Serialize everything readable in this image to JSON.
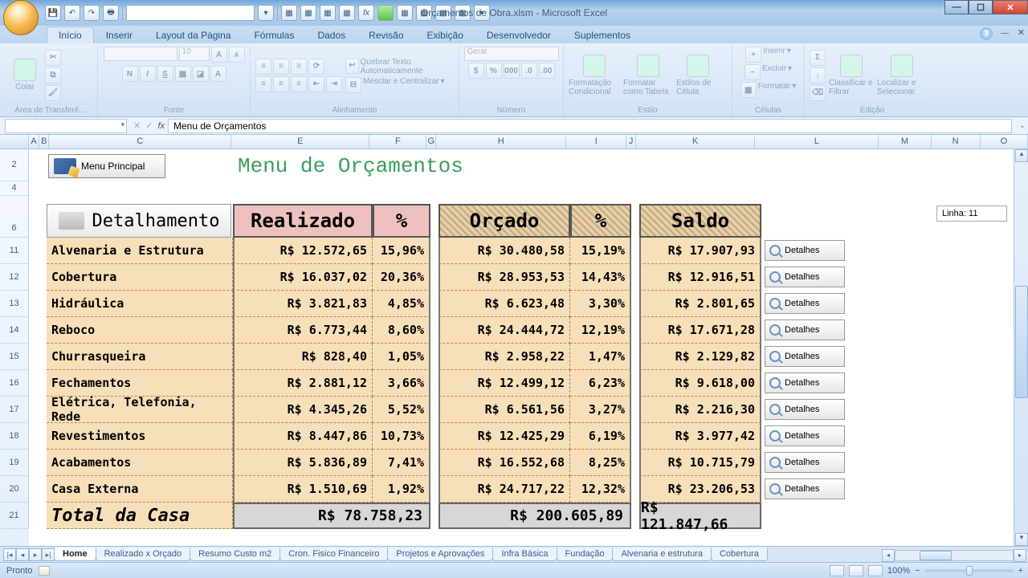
{
  "app": {
    "title": "Orçamentos de Obra.xlsm - Microsoft Excel"
  },
  "ribbon_tabs": [
    "Início",
    "Inserir",
    "Layout da Página",
    "Fórmulas",
    "Dados",
    "Revisão",
    "Exibição",
    "Desenvolvedor",
    "Suplementos"
  ],
  "ribbon_groups": {
    "clipboard": "Área de Transferê...",
    "clipboard_paste": "Colar",
    "font": "Fonte",
    "fontsize": "10",
    "alignment": "Alinhamento",
    "wrap": "Quebrar Texto Automaticamente",
    "merge": "Mesclar e Centralizar",
    "number": "Número",
    "number_format": "Geral",
    "styles": "Estilo",
    "cf": "Formatação Condicional",
    "tbl": "Formatar como Tabela",
    "cellst": "Estilos de Célula",
    "cells": "Células",
    "ins": "Inserir",
    "del": "Excluir",
    "fmt": "Formatar",
    "editing": "Edição",
    "sort": "Classificar e Filtrar",
    "find": "Localizar e Selecionar"
  },
  "formula_bar": {
    "namebox": "",
    "formula": "Menu de Orçamentos"
  },
  "columns": [
    "A",
    "B",
    "C",
    "E",
    "F",
    "G",
    "H",
    "I",
    "J",
    "K",
    "L",
    "M",
    "N",
    "O"
  ],
  "row_numbers": [
    "2",
    "4",
    "6",
    "11",
    "12",
    "13",
    "14",
    "15",
    "16",
    "17",
    "18",
    "19",
    "20",
    "21"
  ],
  "menu_principal": "Menu Principal",
  "page_title": "Menu de Orçamentos",
  "linha": "Linha: 11",
  "detal": "Detalhamento",
  "headers": {
    "realizado": "Realizado",
    "r_pct": "%",
    "orcado": "Orçado",
    "o_pct": "%",
    "saldo": "Saldo"
  },
  "det_label": "Detalhes",
  "rows": [
    {
      "name": "Alvenaria e Estrutura",
      "realizado": "R$ 12.572,65",
      "r_pct": "15,96%",
      "orcado": "R$ 30.480,58",
      "o_pct": "15,19%",
      "saldo": "R$ 17.907,93"
    },
    {
      "name": "Cobertura",
      "realizado": "R$ 16.037,02",
      "r_pct": "20,36%",
      "orcado": "R$ 28.953,53",
      "o_pct": "14,43%",
      "saldo": "R$ 12.916,51"
    },
    {
      "name": "Hidráulica",
      "realizado": "R$ 3.821,83",
      "r_pct": "4,85%",
      "orcado": "R$ 6.623,48",
      "o_pct": "3,30%",
      "saldo": "R$ 2.801,65"
    },
    {
      "name": "Reboco",
      "realizado": "R$ 6.773,44",
      "r_pct": "8,60%",
      "orcado": "R$ 24.444,72",
      "o_pct": "12,19%",
      "saldo": "R$ 17.671,28"
    },
    {
      "name": "Churrasqueira",
      "realizado": "R$ 828,40",
      "r_pct": "1,05%",
      "orcado": "R$ 2.958,22",
      "o_pct": "1,47%",
      "saldo": "R$ 2.129,82"
    },
    {
      "name": "Fechamentos",
      "realizado": "R$ 2.881,12",
      "r_pct": "3,66%",
      "orcado": "R$ 12.499,12",
      "o_pct": "6,23%",
      "saldo": "R$ 9.618,00"
    },
    {
      "name": "Elétrica, Telefonia, Rede",
      "realizado": "R$ 4.345,26",
      "r_pct": "5,52%",
      "orcado": "R$ 6.561,56",
      "o_pct": "3,27%",
      "saldo": "R$ 2.216,30"
    },
    {
      "name": "Revestimentos",
      "realizado": "R$ 8.447,86",
      "r_pct": "10,73%",
      "orcado": "R$ 12.425,29",
      "o_pct": "6,19%",
      "saldo": "R$ 3.977,42"
    },
    {
      "name": "Acabamentos",
      "realizado": "R$ 5.836,89",
      "r_pct": "7,41%",
      "orcado": "R$ 16.552,68",
      "o_pct": "8,25%",
      "saldo": "R$ 10.715,79"
    },
    {
      "name": "Casa Externa",
      "realizado": "R$ 1.510,69",
      "r_pct": "1,92%",
      "orcado": "R$ 24.717,22",
      "o_pct": "12,32%",
      "saldo": "R$ 23.206,53"
    }
  ],
  "total": {
    "label": "Total da Casa",
    "realizado": "R$ 78.758,23",
    "orcado": "R$ 200.605,89",
    "saldo": "R$ 121.847,66"
  },
  "sheet_tabs": [
    "Home",
    "Realizado x Orçado",
    "Resumo Custo m2",
    "Cron. Fisico Financeiro",
    "Projetos e Aprovações",
    "Infra Básica",
    "Fundação",
    "Alvenaria e estrutura",
    "Cobertura"
  ],
  "status": {
    "ready": "Pronto",
    "zoom": "100%"
  }
}
